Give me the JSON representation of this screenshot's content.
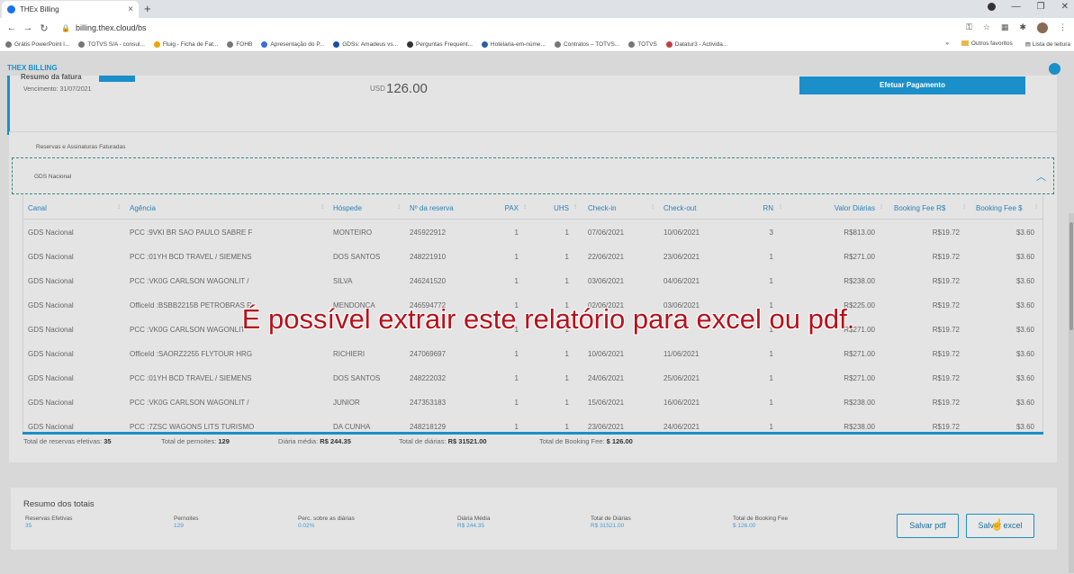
{
  "browser": {
    "tab_title": "THEx Billing",
    "tab_close": "×",
    "new_tab": "+",
    "url": "billing.thex.cloud/bs",
    "bookmarks": [
      "Grátis PowerPoint I...",
      "TOTVS S/A - consul...",
      "Fluig - Ficha de Fat...",
      "FOHB",
      "Apresentação do P...",
      "GDSs: Amadeus vs...",
      "Perguntas Frequent...",
      "Hotelaria-em-núme...",
      "Contratos – TOTVS...",
      "TOTVS",
      "Datatur3 - Activida..."
    ],
    "bookmark_more": "»",
    "other_favorites": "Outros favoritos",
    "reading_list": "Lista de leitura"
  },
  "app": {
    "name": "THEX BILLING",
    "summary": {
      "title": "Resumo da fatura",
      "due": "Vencimento: 31/07/2021",
      "currency": "USD",
      "amount": "126.00",
      "pay_button": "Efetuar Pagamento"
    },
    "section_title": "Reservas e Assinaturas Faturadas",
    "group_label": "GDS Nacional",
    "columns": [
      "Canal",
      "Agência",
      "Hóspede",
      "Nº da reserva",
      "PAX",
      "UHS",
      "Check-in",
      "Check-out",
      "RN",
      "Valor Diárias",
      "Booking Fee R$",
      "Booking Fee $"
    ],
    "rows": [
      [
        "GDS Nacional",
        "PCC :9VKI BR SAO PAULO SABRE F",
        "MONTEIRO",
        "245922912",
        "1",
        "1",
        "07/06/2021",
        "10/06/2021",
        "3",
        "R$813.00",
        "R$19.72",
        "$3.60"
      ],
      [
        "GDS Nacional",
        "PCC :01YH BCD TRAVEL / SIEMENS",
        "DOS SANTOS",
        "248221910",
        "1",
        "1",
        "22/06/2021",
        "23/06/2021",
        "1",
        "R$271.00",
        "R$19.72",
        "$3.60"
      ],
      [
        "GDS Nacional",
        "PCC :VK0G CARLSON WAGONLIT /",
        "SILVA",
        "246241520",
        "1",
        "1",
        "03/06/2021",
        "04/06/2021",
        "1",
        "R$238.00",
        "R$19.72",
        "$3.60"
      ],
      [
        "GDS Nacional",
        "OfficeId :BSBB2215B PETROBRAS R",
        "MENDONCA",
        "246594772",
        "1",
        "1",
        "02/06/2021",
        "03/06/2021",
        "1",
        "R$225.00",
        "R$19.72",
        "$3.60"
      ],
      [
        "GDS Nacional",
        "PCC :VK0G CARLSON WAGONLIT",
        "",
        "",
        "1",
        "1",
        "",
        "",
        "1",
        "R$271.00",
        "R$19.72",
        "$3.60"
      ],
      [
        "GDS Nacional",
        "OfficeId :SAORZ2255 FLYTOUR HRG",
        "RICHIERI",
        "247069697",
        "1",
        "1",
        "10/06/2021",
        "11/06/2021",
        "1",
        "R$271.00",
        "R$19.72",
        "$3.60"
      ],
      [
        "GDS Nacional",
        "PCC :01YH BCD TRAVEL / SIEMENS",
        "DOS SANTOS",
        "248222032",
        "1",
        "1",
        "24/06/2021",
        "25/06/2021",
        "1",
        "R$271.00",
        "R$19.72",
        "$3.60"
      ],
      [
        "GDS Nacional",
        "PCC :VK0G CARLSON WAGONLIT /",
        "JUNIOR",
        "247353183",
        "1",
        "1",
        "15/06/2021",
        "16/06/2021",
        "1",
        "R$238.00",
        "R$19.72",
        "$3.60"
      ],
      [
        "GDS Nacional",
        "PCC :7ZSC WAGONS LITS TURISMO",
        "DA CUNHA",
        "248218129",
        "1",
        "1",
        "23/06/2021",
        "24/06/2021",
        "1",
        "R$238.00",
        "R$19.72",
        "$3.60"
      ]
    ],
    "totals": {
      "reservas_label": "Total de reservas efetivas:",
      "reservas_value": "35",
      "pernoites_label": "Total de pernoites:",
      "pernoites_value": "129",
      "diaria_media_label": "Diária média:",
      "diaria_media_value": "R$ 244.35",
      "diarias_label": "Total de diárias:",
      "diarias_value": "R$ 31521.00",
      "booking_label": "Total de Booking Fee:",
      "booking_value": "$ 126.00"
    },
    "resumo": {
      "title": "Resumo dos totais",
      "items": [
        {
          "label": "Reservas Efetivas",
          "value": "35"
        },
        {
          "label": "Pernoites",
          "value": "129"
        },
        {
          "label": "Perc. sobre as diárias",
          "value": "0.02%"
        },
        {
          "label": "Diária Média",
          "value": "R$ 244.35"
        },
        {
          "label": "Total de Diárias",
          "value": "R$ 31521.00"
        },
        {
          "label": "Total de Booking Fee",
          "value": "$ 126.00"
        }
      ],
      "save_pdf": "Salvar pdf",
      "save_excel": "Salvar excel"
    }
  },
  "overlay_caption": "É possível extrair este relatório para excel ou pdf."
}
